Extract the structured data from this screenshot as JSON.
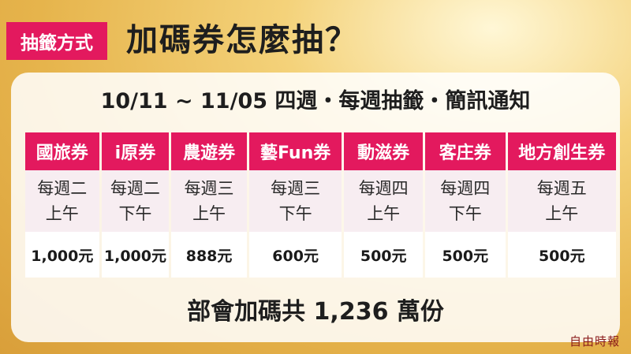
{
  "header": {
    "tag_label": "抽籤方式",
    "title": "加碼券怎麼抽？"
  },
  "panel": {
    "subtitle": "10/11 ~ 11/05 四週・每週抽籤・簡訊通知",
    "total": "部會加碼共 1,236 萬份"
  },
  "table": {
    "columns": [
      {
        "name": "國旅券",
        "day": "每週二",
        "time": "上午",
        "amount": "1,000元"
      },
      {
        "name": "i原券",
        "day": "每週二",
        "time": "下午",
        "amount": "1,000元"
      },
      {
        "name": "農遊券",
        "day": "每週三",
        "time": "上午",
        "amount": "888元"
      },
      {
        "name": "藝Fun券",
        "day": "每週三",
        "time": "下午",
        "amount": "600元"
      },
      {
        "name": "動滋券",
        "day": "每週四",
        "time": "上午",
        "amount": "500元"
      },
      {
        "name": "客庄券",
        "day": "每週四",
        "time": "下午",
        "amount": "500元"
      },
      {
        "name": "地方創生券",
        "day": "每週五",
        "time": "上午",
        "amount": "500元"
      }
    ]
  },
  "credit": "自由時報",
  "colors": {
    "accent": "#e3195e",
    "background_gold": "#e6b44c",
    "panel": "#ffffff"
  }
}
